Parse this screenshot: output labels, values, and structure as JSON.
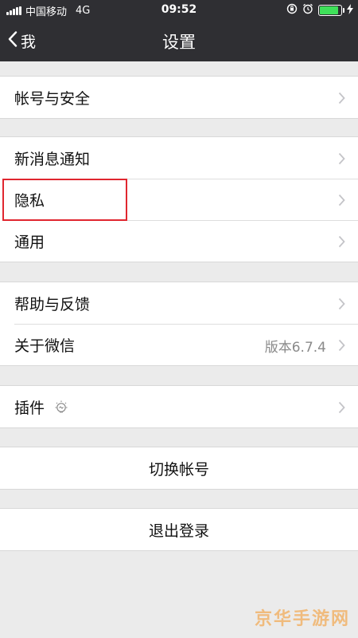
{
  "status_bar": {
    "carrier": "中国移动",
    "network": "4G",
    "time": "09:52",
    "battery_level": 0.9,
    "battery_color": "#3fe05a"
  },
  "nav": {
    "back_label": "我",
    "title": "设置"
  },
  "groups": [
    {
      "items": [
        {
          "label": "帐号与安全"
        }
      ]
    },
    {
      "items": [
        {
          "label": "新消息通知"
        },
        {
          "label": "隐私"
        },
        {
          "label": "通用"
        }
      ]
    },
    {
      "items": [
        {
          "label": "帮助与反馈"
        },
        {
          "label": "关于微信",
          "value": "版本6.7.4"
        }
      ]
    },
    {
      "items": [
        {
          "label": "插件",
          "icon": "plugin-bulb-icon"
        }
      ]
    }
  ],
  "actions": {
    "switch_account": "切换帐号",
    "logout": "退出登录"
  },
  "highlight": {
    "target": "隐私",
    "color": "#e0262f"
  },
  "watermark": "京华手游网"
}
